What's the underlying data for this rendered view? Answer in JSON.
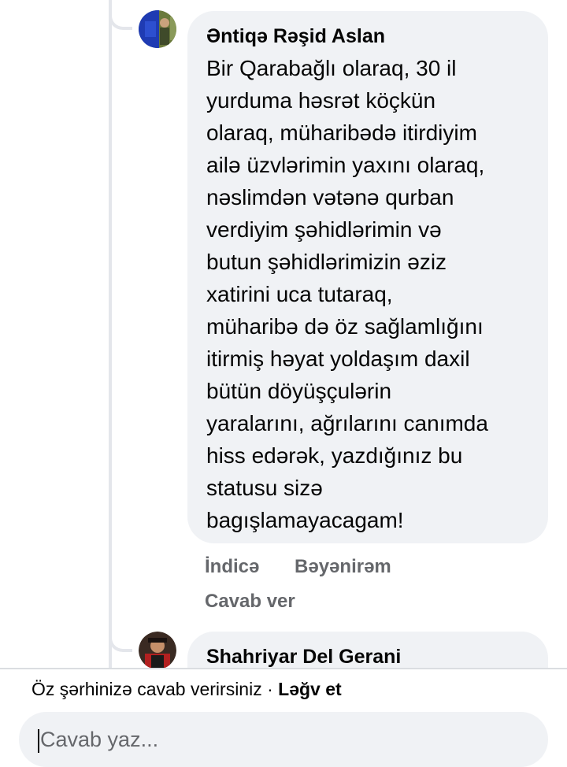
{
  "comments": [
    {
      "author": "Əntiqə Rəşid Aslan",
      "text": "Bir Qarabağlı olaraq,  30 il\nyurduma həsrət köçkün\nolaraq, müharibədə itirdiyim\nailə üzvlərimin yaxını olaraq,\nnəslimdən vətənə qurban\nverdiyim şəhidlərimin və\nbutun şəhidlərimizin əziz\nxatirini uca tutaraq,\nmüharibə də öz sağlamlığını\nitirmiş həyat yoldaşım daxil\nbütün döyüşçulərin\nyaralarını, ağrılarını canımda\nhiss edərək, yazdığınız bu\nstatusu sizə\nbagışlamayacagam!",
      "time": "İndicə",
      "like_label": "Bəyənirəm",
      "reply_label": "Cavab ver"
    },
    {
      "author": "Shahriyar Del Gerani"
    }
  ],
  "reply_bar": {
    "info": "Öz şərhinizə cavab verirsiniz",
    "separator": " · ",
    "cancel": "Ləğv et",
    "placeholder": "Cavab yaz..."
  },
  "colors": {
    "bubble": "#f0f2f5",
    "muted_text": "#65676b",
    "thread_line": "#e4e6eb"
  }
}
